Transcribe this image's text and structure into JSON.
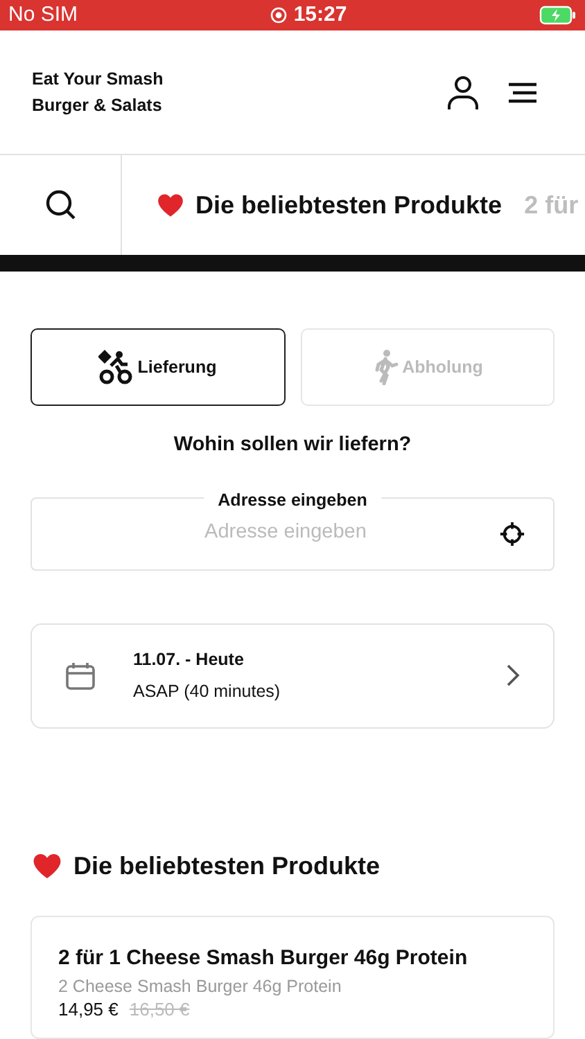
{
  "status_bar": {
    "carrier": "No SIM",
    "time": "15:27"
  },
  "header": {
    "title_lines": [
      "Eat Your Smash",
      "Burger & Salats"
    ]
  },
  "category_tabs": [
    {
      "label": "Die beliebtesten Produkte",
      "selected": true,
      "kind": "favorites"
    },
    {
      "label": "2 für",
      "selected": false,
      "kind": "category"
    }
  ],
  "order_modes": [
    {
      "label": "Lieferung",
      "selected": true,
      "kind": "delivery"
    },
    {
      "label": "Abholung",
      "selected": false,
      "kind": "pickup"
    }
  ],
  "question": "Wohin sollen wir liefern?",
  "address_field": {
    "label": "Adresse eingeben",
    "placeholder": "Adresse eingeben"
  },
  "time_slot": {
    "date": "11.07. - Heute",
    "time": "ASAP (40 minutes)"
  },
  "section": {
    "title": "Die beliebtesten Produkte"
  },
  "products": [
    {
      "name": "2 für 1 Cheese Smash Burger 46g Protein",
      "description": "2 Cheese Smash Burger 46g Protein",
      "price": "14,95 €",
      "old_price": "16,50 €"
    }
  ]
}
